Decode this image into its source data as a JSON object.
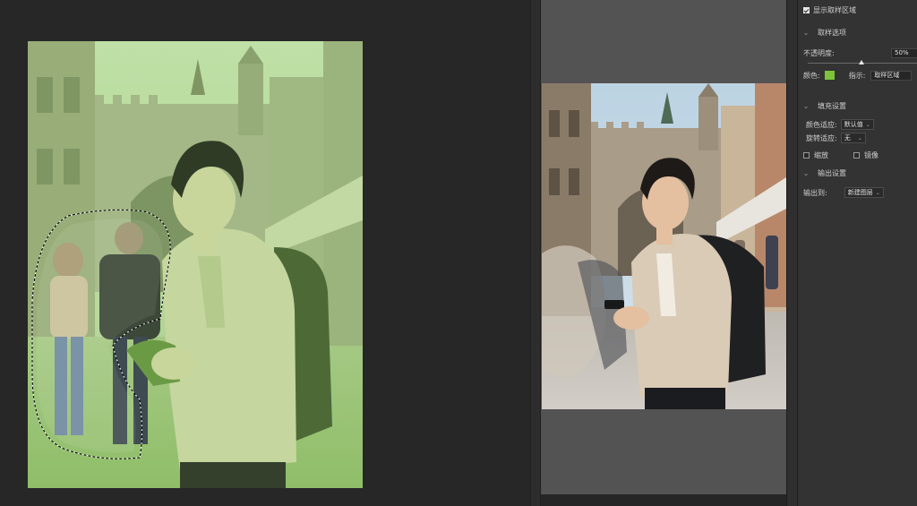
{
  "panel": {
    "show_sample_area": {
      "label": "显示取样区域",
      "checked": true
    },
    "sample_options": {
      "title": "取样选项",
      "opacity_label": "不透明度:",
      "opacity_value": "50%",
      "opacity_fraction": 0.5,
      "color_label": "颜色:",
      "color_value": "#7ec33a",
      "indicate_label": "指示:",
      "indicate_value": "取样区域"
    },
    "fill_settings": {
      "title": "填充设置",
      "color_adapt_label": "颜色适应:",
      "color_adapt_value": "默认值",
      "rotate_adapt_label": "旋转适应:",
      "rotate_adapt_value": "无",
      "scale_label": "缩放",
      "scale_checked": false,
      "mirror_label": "镜像",
      "mirror_checked": false
    },
    "output_settings": {
      "title": "输出设置",
      "output_to_label": "输出到:",
      "output_to_value": "新建图层"
    }
  },
  "icons": {
    "chevron": "chevron-down-icon",
    "checkbox": "checkbox-icon"
  },
  "colors": {
    "sample_overlay": "#7ec33a",
    "panel_bg": "#333333",
    "canvas_bg": "#535353"
  }
}
